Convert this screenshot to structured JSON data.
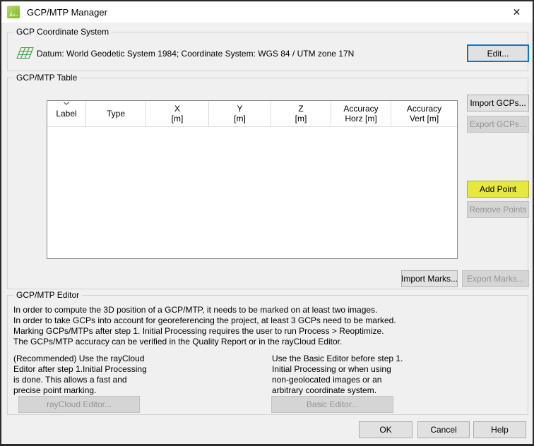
{
  "window": {
    "title": "GCP/MTP Manager",
    "close_icon": "✕"
  },
  "coord_system": {
    "label": "GCP Coordinate System",
    "datum": "Datum: World Geodetic System 1984; Coordinate System: WGS 84 / UTM zone 17N",
    "edit_button": "Edit..."
  },
  "gcp_table": {
    "label": "GCP/MTP Table",
    "columns": [
      "Label",
      "Type",
      "X\n[m]",
      "Y\n[m]",
      "Z\n[m]",
      "Accuracy\nHorz [m]",
      "Accuracy\nVert [m]"
    ],
    "rows": [],
    "import_gcps": "Import GCPs...",
    "export_gcps": "Export GCPs...",
    "add_point": "Add Point",
    "remove_points": "Remove Points",
    "import_marks": "Import Marks...",
    "export_marks": "Export Marks..."
  },
  "editor": {
    "label": "GCP/MTP Editor",
    "lines": [
      "In order to compute the 3D position of a GCP/MTP, it needs to be marked on at least two images.",
      "In order to take GCPs into account for georeferencing the project, at least 3 GCPs need to be marked.",
      "Marking GCPs/MTPs after step 1. Initial Processing requires the user to run Process > Reoptimize.",
      "The GCPs/MTP accuracy can be verified in the Quality Report or in the rayCloud Editor."
    ],
    "raycloud_note": "(Recommended) Use the rayCloud\nEditor after step 1.Initial Processing\nis done. This allows a fast and\nprecise point marking.",
    "basic_note": "Use the Basic Editor before step 1.\nInitial Processing or when using\nnon-geolocated images or an\narbitrary coordinate system.",
    "raycloud_button": "rayCloud Editor...",
    "basic_button": "Basic Editor..."
  },
  "footer": {
    "ok": "OK",
    "cancel": "Cancel",
    "help": "Help"
  },
  "colors": {
    "add_point_bg": "#e7e83e",
    "focus_blue": "#0078d7",
    "icon_green": "#3e9b3e",
    "logo_green": "#93c63f"
  }
}
